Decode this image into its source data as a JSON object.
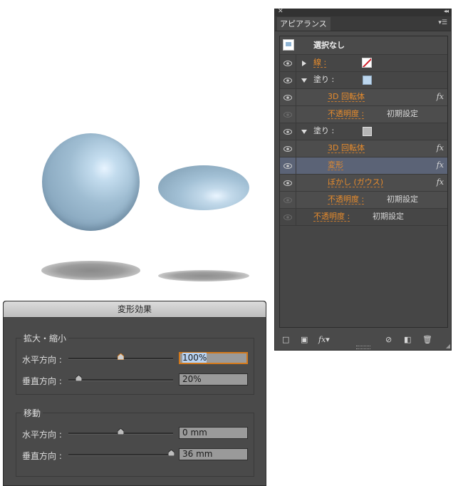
{
  "appearance_panel": {
    "tab_label": "アピアランス",
    "header_title": "選択なし",
    "rows": {
      "stroke_label": "線 :",
      "fill1_label": "塗り :",
      "fill1_effect": "3D 回転体",
      "fill1_opacity_label": "不透明度 :",
      "fill1_opacity_value": "初期設定",
      "fill2_label": "塗り :",
      "fill2_effect1": "3D 回転体",
      "fill2_effect2": "変形",
      "fill2_effect3": "ぼかし (ガウス)",
      "fill2_opacity_label": "不透明度 :",
      "fill2_opacity_value": "初期設定",
      "opacity_label": "不透明度 :",
      "opacity_value": "初期設定"
    },
    "fx_mark": "fx",
    "bottom_fx": "fx",
    "colors": {
      "stroke_swatch": "#d0202a",
      "fill1_swatch": "#bcd6ee",
      "fill2_swatch": "#b6b6b6",
      "selected_row": "#5b6376",
      "label_orange": "#e88c2c"
    }
  },
  "dialog": {
    "title": "変形効果",
    "scale": {
      "group_label": "拡大・縮小",
      "horizontal_label": "水平方向 :",
      "horizontal_value": "100%",
      "horizontal_level": 0.5,
      "vertical_label": "垂直方向 :",
      "vertical_value": "20%",
      "vertical_level": 0.1
    },
    "move": {
      "group_label": "移動",
      "horizontal_label": "水平方向 :",
      "horizontal_value": "0 mm",
      "horizontal_level": 0.5,
      "vertical_label": "垂直方向 :",
      "vertical_value": "36 mm",
      "vertical_level": 0.98
    }
  }
}
